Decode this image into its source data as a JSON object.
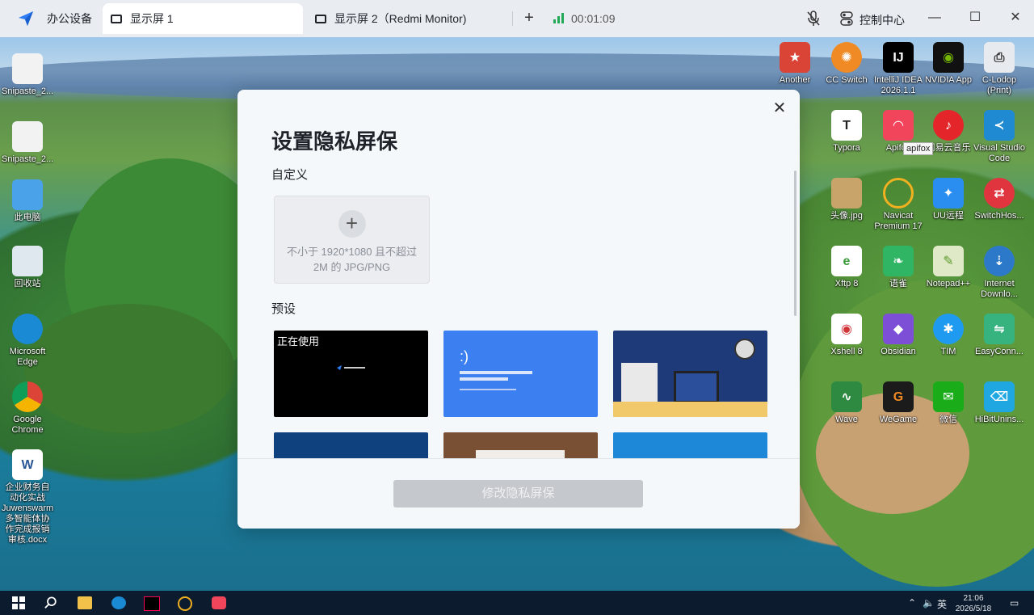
{
  "toolbar": {
    "app_name": "办公设备",
    "tabs": [
      {
        "label": "显示屏 1"
      },
      {
        "label": "显示屏 2（Redmi Monitor)"
      }
    ],
    "add_tab": "+",
    "timer": "00:01:09",
    "control_center": "控制中心",
    "minimize": "—",
    "maximize": "☐",
    "close": "✕"
  },
  "desktop_icons": {
    "left": [
      {
        "label": "Snipaste_2..."
      },
      {
        "label": "Snipaste_2..."
      },
      {
        "label": "此电脑"
      },
      {
        "label": "回收站"
      },
      {
        "label": "Microsoft Edge"
      },
      {
        "label": "Google Chrome"
      },
      {
        "label": "企业财务自动化实战 Juwenswarm 多智能体协作完成报销审核.docx"
      }
    ],
    "right": [
      {
        "label": "Another"
      },
      {
        "label": "CC Switch"
      },
      {
        "label": "IntelliJ IDEA 2026.1.1"
      },
      {
        "label": "NVIDIA App"
      },
      {
        "label": "C-Lodop (Print)"
      },
      {
        "label": "Typora"
      },
      {
        "label": "Apifox"
      },
      {
        "label": "网易云音乐"
      },
      {
        "label": "Visual Studio Code"
      },
      {
        "label": "头像.jpg"
      },
      {
        "label": "Navicat Premium 17"
      },
      {
        "label": "UU远程"
      },
      {
        "label": "SwitchHos..."
      },
      {
        "label": "Xftp 8"
      },
      {
        "label": "语雀"
      },
      {
        "label": "Notepad++"
      },
      {
        "label": "Internet Downlo..."
      },
      {
        "label": "Xshell 8"
      },
      {
        "label": "Obsidian"
      },
      {
        "label": "TIM"
      },
      {
        "label": "EasyConn..."
      },
      {
        "label": "Wave"
      },
      {
        "label": "WeGame"
      },
      {
        "label": "微信"
      },
      {
        "label": "HiBitUnins..."
      }
    ],
    "tooltip": "apifox"
  },
  "modal": {
    "title": "设置隐私屏保",
    "custom_section": "自定义",
    "upload_hint": "不小于 1920*1080 且不超过 2M 的 JPG/PNG",
    "preset_section": "预设",
    "presets": [
      {
        "badge": "正在使用",
        "caption": "",
        "bg": "#000000"
      },
      {
        "badge": "",
        "caption": ":)",
        "bg": "#3b7ff0"
      },
      {
        "badge": "",
        "caption": "",
        "bg": "#1f3a78"
      }
    ],
    "submit": "修改隐私屏保",
    "close": "✕"
  },
  "taskbar": {
    "ime": "英",
    "time": "21:06",
    "date": "2026/5/18"
  },
  "colors": {
    "toolbar_bg": "#e9edf2",
    "modal_bg": "#f5f8fb",
    "accent_green": "#21a957",
    "taskbar_bg": "#0c1b2e",
    "submit_disabled": "#c5c8cc"
  }
}
